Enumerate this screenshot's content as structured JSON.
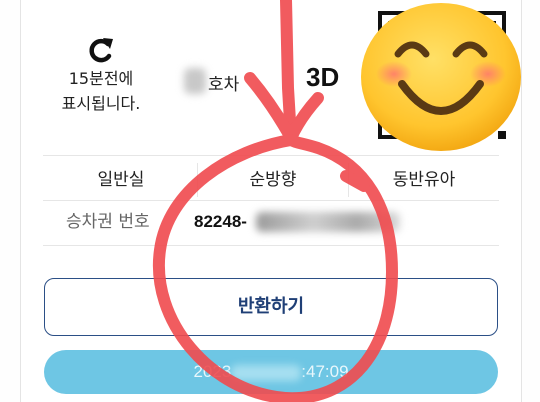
{
  "refresh": {
    "icon": "refresh-icon",
    "line1": "15분전에",
    "line2": "표시됩니다."
  },
  "car": {
    "label": "호차"
  },
  "seat": {
    "label": "3D"
  },
  "qr": {
    "icon": "qr-code"
  },
  "sticker": {
    "icon": "smiling-face-emoji"
  },
  "ticket_info": {
    "class": "일반실",
    "direction": "순방향",
    "companion": "동반유아",
    "number_label": "승차권 번호",
    "number_value": "82248-"
  },
  "actions": {
    "refund_label": "반환하기"
  },
  "time_bar": {
    "prefix": "2023",
    "suffix": ":47:09"
  },
  "colors": {
    "refund_border": "#2b4f86",
    "time_bar_bg": "#6ec6e4",
    "annotation": "#f04a4e"
  }
}
